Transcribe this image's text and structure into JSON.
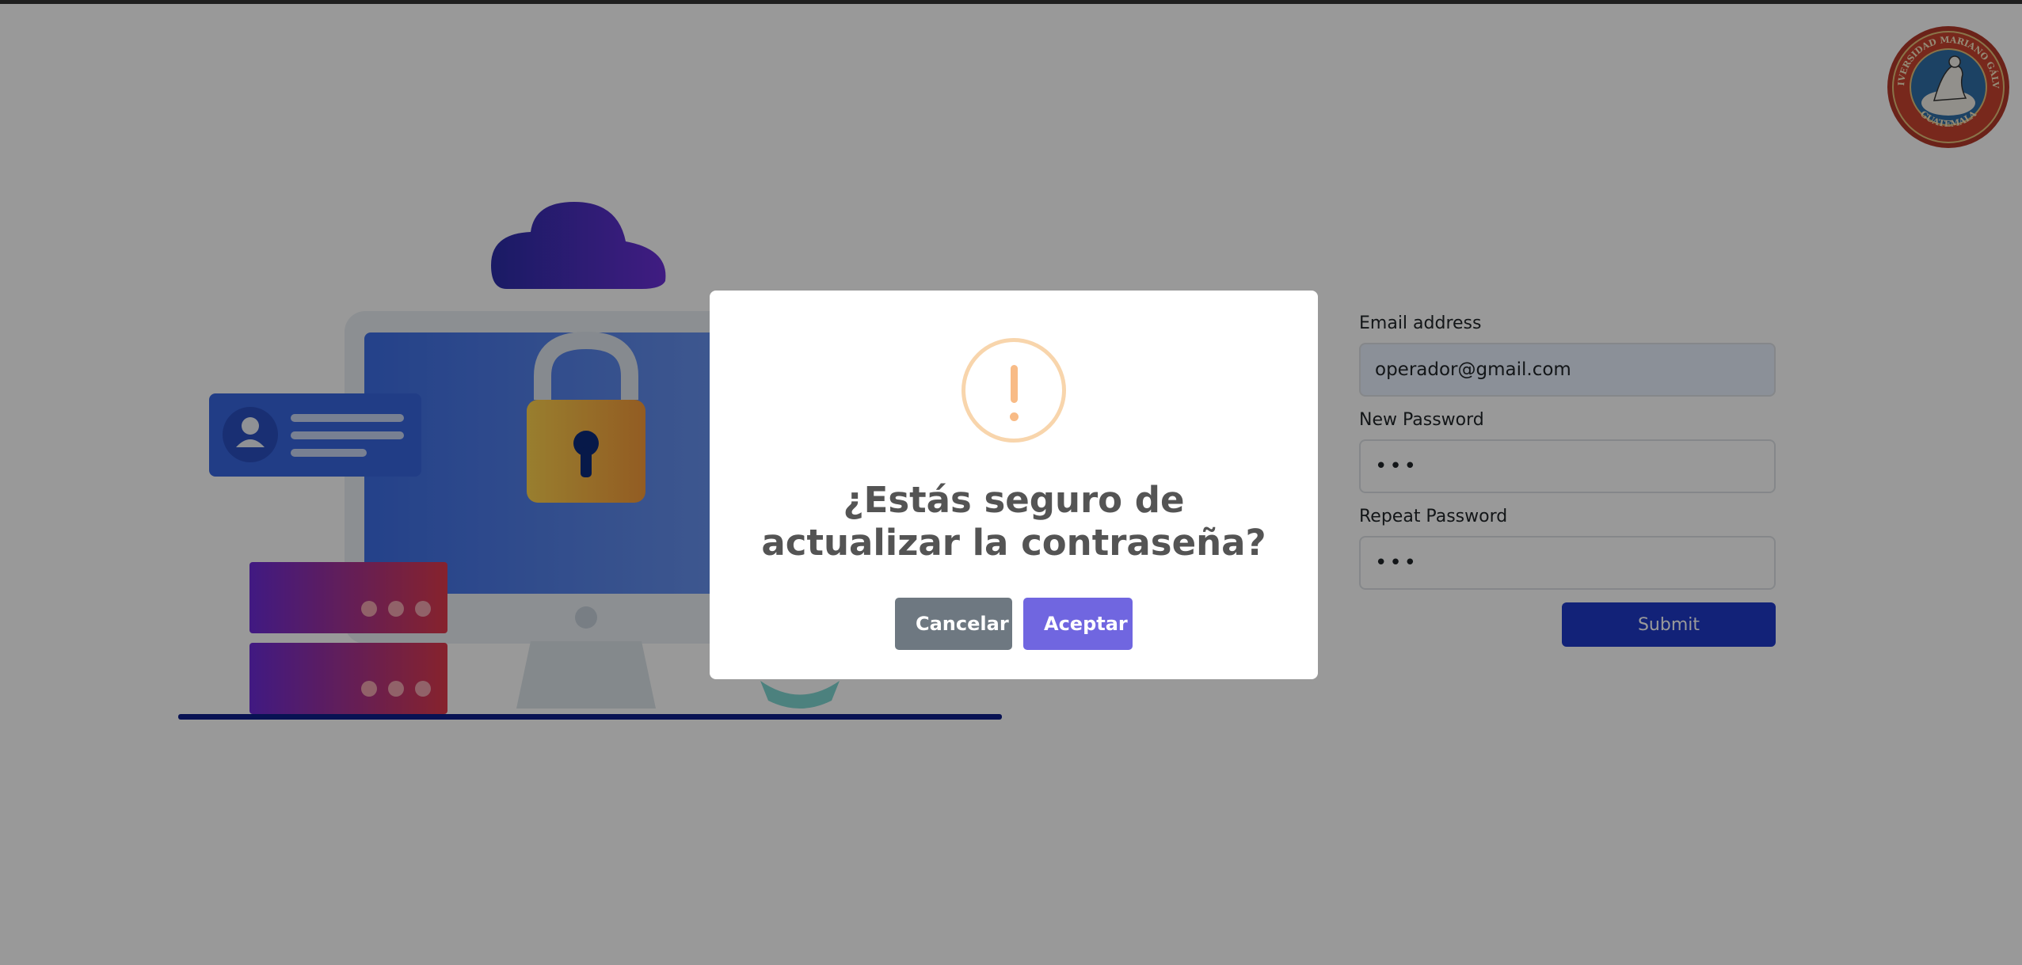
{
  "form": {
    "email_label": "Email address",
    "email_value": "operador@gmail.com",
    "new_password_label": "New Password",
    "new_password_value": "•••",
    "repeat_password_label": "Repeat Password",
    "repeat_password_value": "•••",
    "submit_label": "Submit"
  },
  "logo": {
    "text_top": "UNIVERSIDAD MARIANO GÁLVEZ",
    "text_bottom": "GUATEMALA"
  },
  "dialog": {
    "icon": "warning-icon",
    "title": "¿Estás seguro de actualizar la contraseña?",
    "cancel_label": "Cancelar",
    "confirm_label": "Aceptar"
  },
  "colors": {
    "confirm": "#7066e0",
    "cancel": "#6e7881",
    "warning": "#f8bb86",
    "submit": "#1e3ac8"
  }
}
